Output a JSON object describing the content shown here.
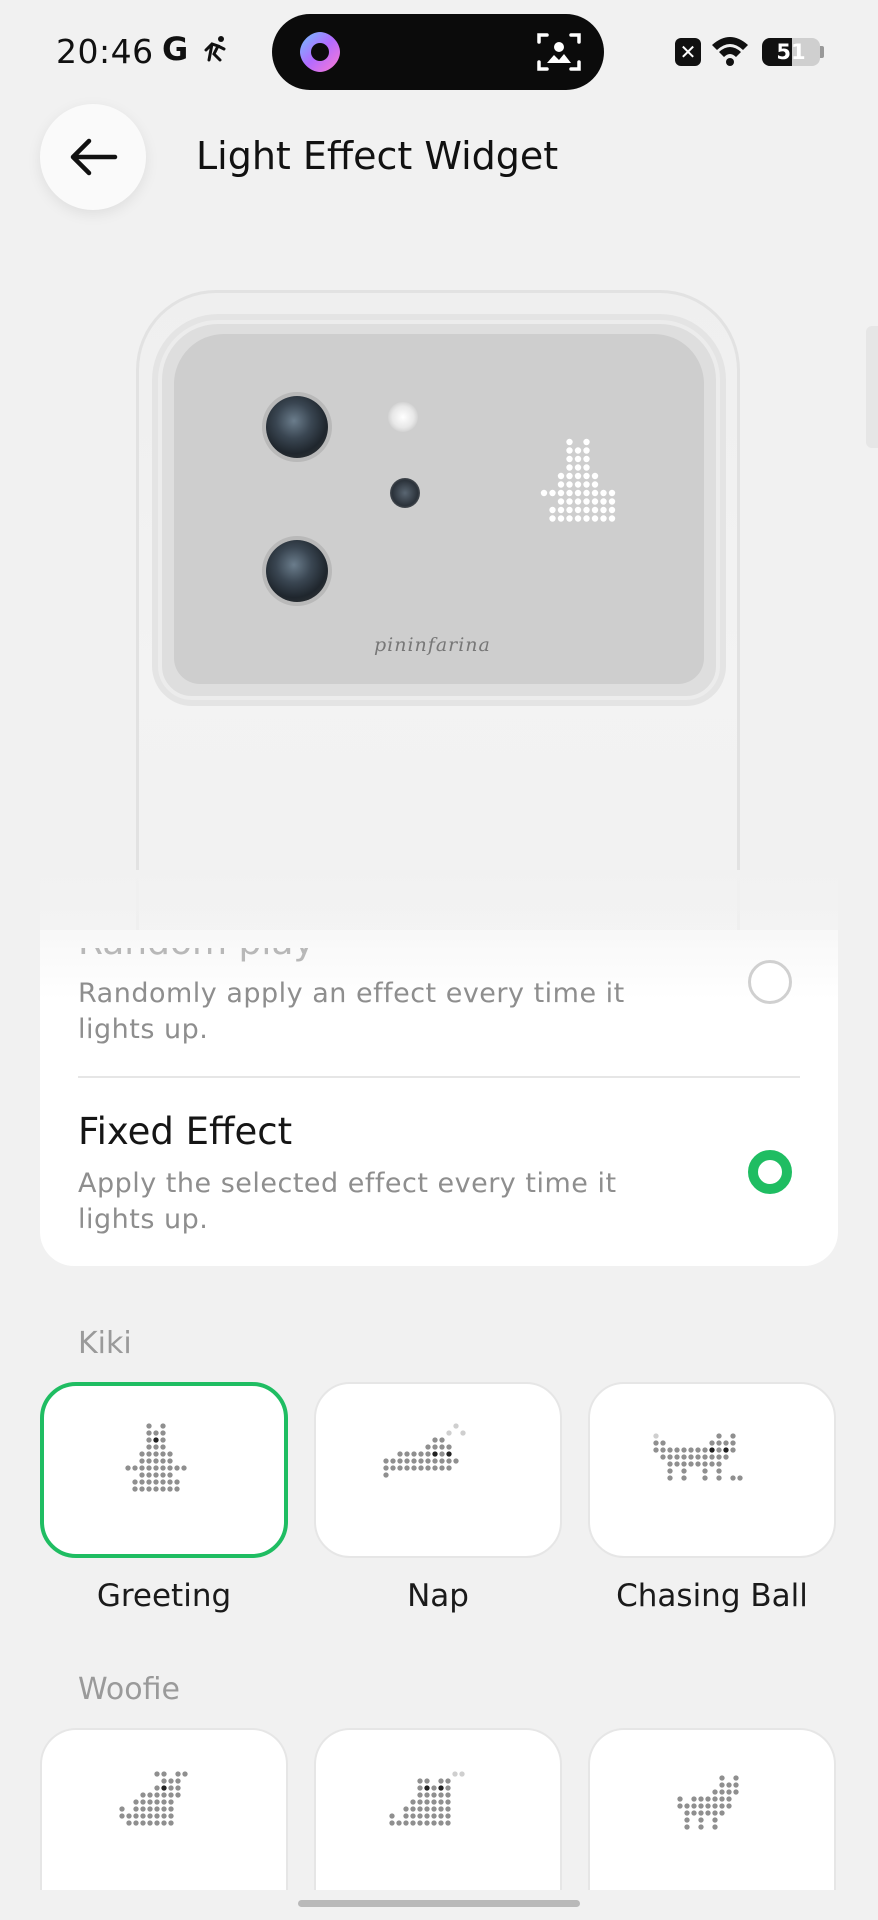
{
  "status_bar": {
    "time": "20:46",
    "g_label": "G",
    "x_label": "✕",
    "battery_level": "51",
    "battery_fraction": 0.51
  },
  "header": {
    "title": "Light Effect Widget",
    "back_icon": "arrow-left-icon"
  },
  "preview": {
    "brand": "pininfarina",
    "led_pattern": "kiki-greeting"
  },
  "options": {
    "random_title": "Random play",
    "random_desc": "Randomly apply an effect every time it lights up.",
    "random_selected": false,
    "fixed_title": "Fixed Effect",
    "fixed_desc": "Apply the selected effect every time it lights up.",
    "fixed_selected": true
  },
  "sections": [
    {
      "label": "Kiki",
      "effects": [
        {
          "label": "Greeting",
          "selected": true,
          "icon": "cat-greeting-icon"
        },
        {
          "label": "Nap",
          "selected": false,
          "icon": "cat-nap-icon"
        },
        {
          "label": "Chasing Ball",
          "selected": false,
          "icon": "cat-chasing-ball-icon"
        }
      ]
    },
    {
      "label": "Woofie",
      "effects": [
        {
          "label": "",
          "selected": false,
          "icon": "dog-sitting-icon"
        },
        {
          "label": "",
          "selected": false,
          "icon": "dog-sniff-icon"
        },
        {
          "label": "",
          "selected": false,
          "icon": "dog-walking-icon"
        }
      ]
    }
  ],
  "colors": {
    "accent": "#1fbd62",
    "background": "#f1f1f1",
    "card": "#ffffff"
  }
}
